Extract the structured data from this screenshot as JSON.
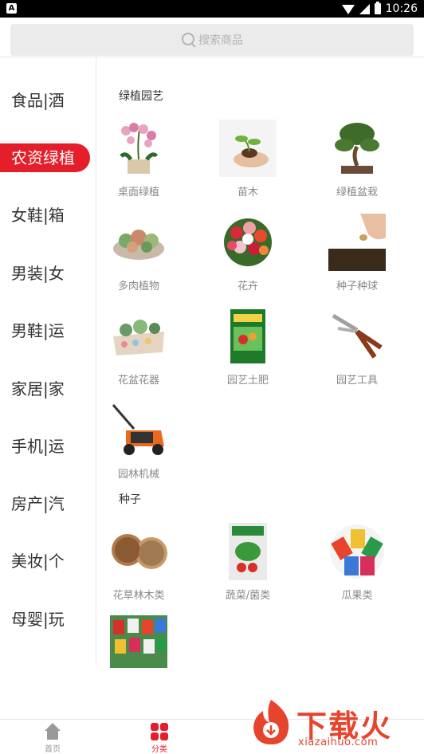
{
  "status_bar": {
    "notification_glyph": "A",
    "time": "10:26"
  },
  "search": {
    "placeholder": "搜索商品"
  },
  "left_nav": {
    "items": [
      {
        "label": "食品|酒"
      },
      {
        "label": "农资绿植"
      },
      {
        "label": "女鞋|箱"
      },
      {
        "label": "男装|女"
      },
      {
        "label": "男鞋|运"
      },
      {
        "label": "家居|家"
      },
      {
        "label": "手机|运"
      },
      {
        "label": "房产|汽"
      },
      {
        "label": "美妆|个"
      },
      {
        "label": "母婴|玩"
      }
    ],
    "active_index": 1
  },
  "sections": [
    {
      "title": "绿植园艺",
      "items": [
        {
          "label": "桌面绿植"
        },
        {
          "label": "苗木"
        },
        {
          "label": "绿植盆栽"
        },
        {
          "label": "多肉植物"
        },
        {
          "label": "花卉"
        },
        {
          "label": "种子种球"
        },
        {
          "label": "花盆花器"
        },
        {
          "label": "园艺土肥"
        },
        {
          "label": "园艺工具"
        },
        {
          "label": "园林机械"
        }
      ]
    },
    {
      "title": "种子",
      "items": [
        {
          "label": "花草林木类"
        },
        {
          "label": "蔬菜/菌类"
        },
        {
          "label": "瓜果类"
        },
        {
          "label": ""
        }
      ]
    }
  ],
  "tab_bar": {
    "tabs": [
      {
        "label": "首页",
        "icon": "home-icon"
      },
      {
        "label": "分类",
        "icon": "category-icon"
      }
    ],
    "active_index": 1
  },
  "watermark": {
    "brand_text": "下载火",
    "url": "xiazaihuo.com"
  },
  "colors": {
    "accent": "#e41e2b",
    "watermark": "#e8442d"
  }
}
